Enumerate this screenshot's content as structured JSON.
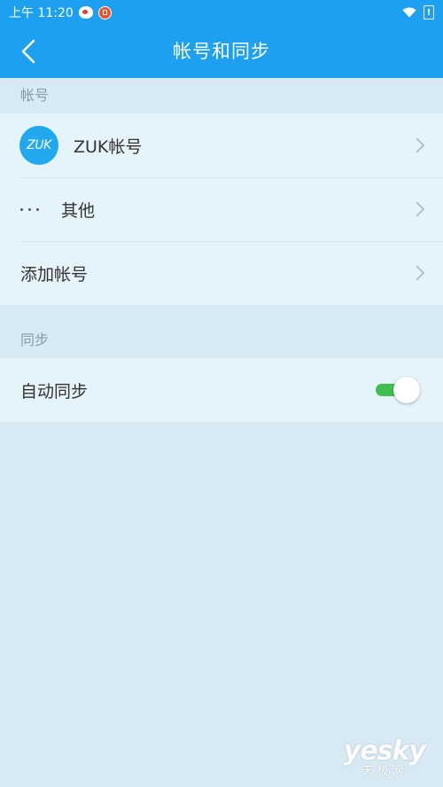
{
  "status_bar": {
    "time": "上午 11:20",
    "notification_icons": [
      "weibo-icon",
      "mi-icon"
    ],
    "system_icons": [
      "wifi-icon",
      "battery-alert-icon"
    ],
    "battery_glyph": "!"
  },
  "app_bar": {
    "title": "帐号和同步",
    "back_icon": "chevron-left-icon",
    "background_color": "#1ea0f0"
  },
  "sections": {
    "accounts": {
      "header": "帐号",
      "items": [
        {
          "label": "ZUK帐号",
          "icon": "zuk-logo-icon",
          "icon_text": "ZUK"
        },
        {
          "label": "其他",
          "icon": "more-dots-icon"
        },
        {
          "label": "添加帐号"
        }
      ]
    },
    "sync": {
      "header": "同步",
      "items": [
        {
          "label": "自动同步",
          "toggle_on": true,
          "toggle_color": "#3fbf4c"
        }
      ]
    }
  },
  "watermark": {
    "main": "yesky",
    "sub": "天极网"
  }
}
